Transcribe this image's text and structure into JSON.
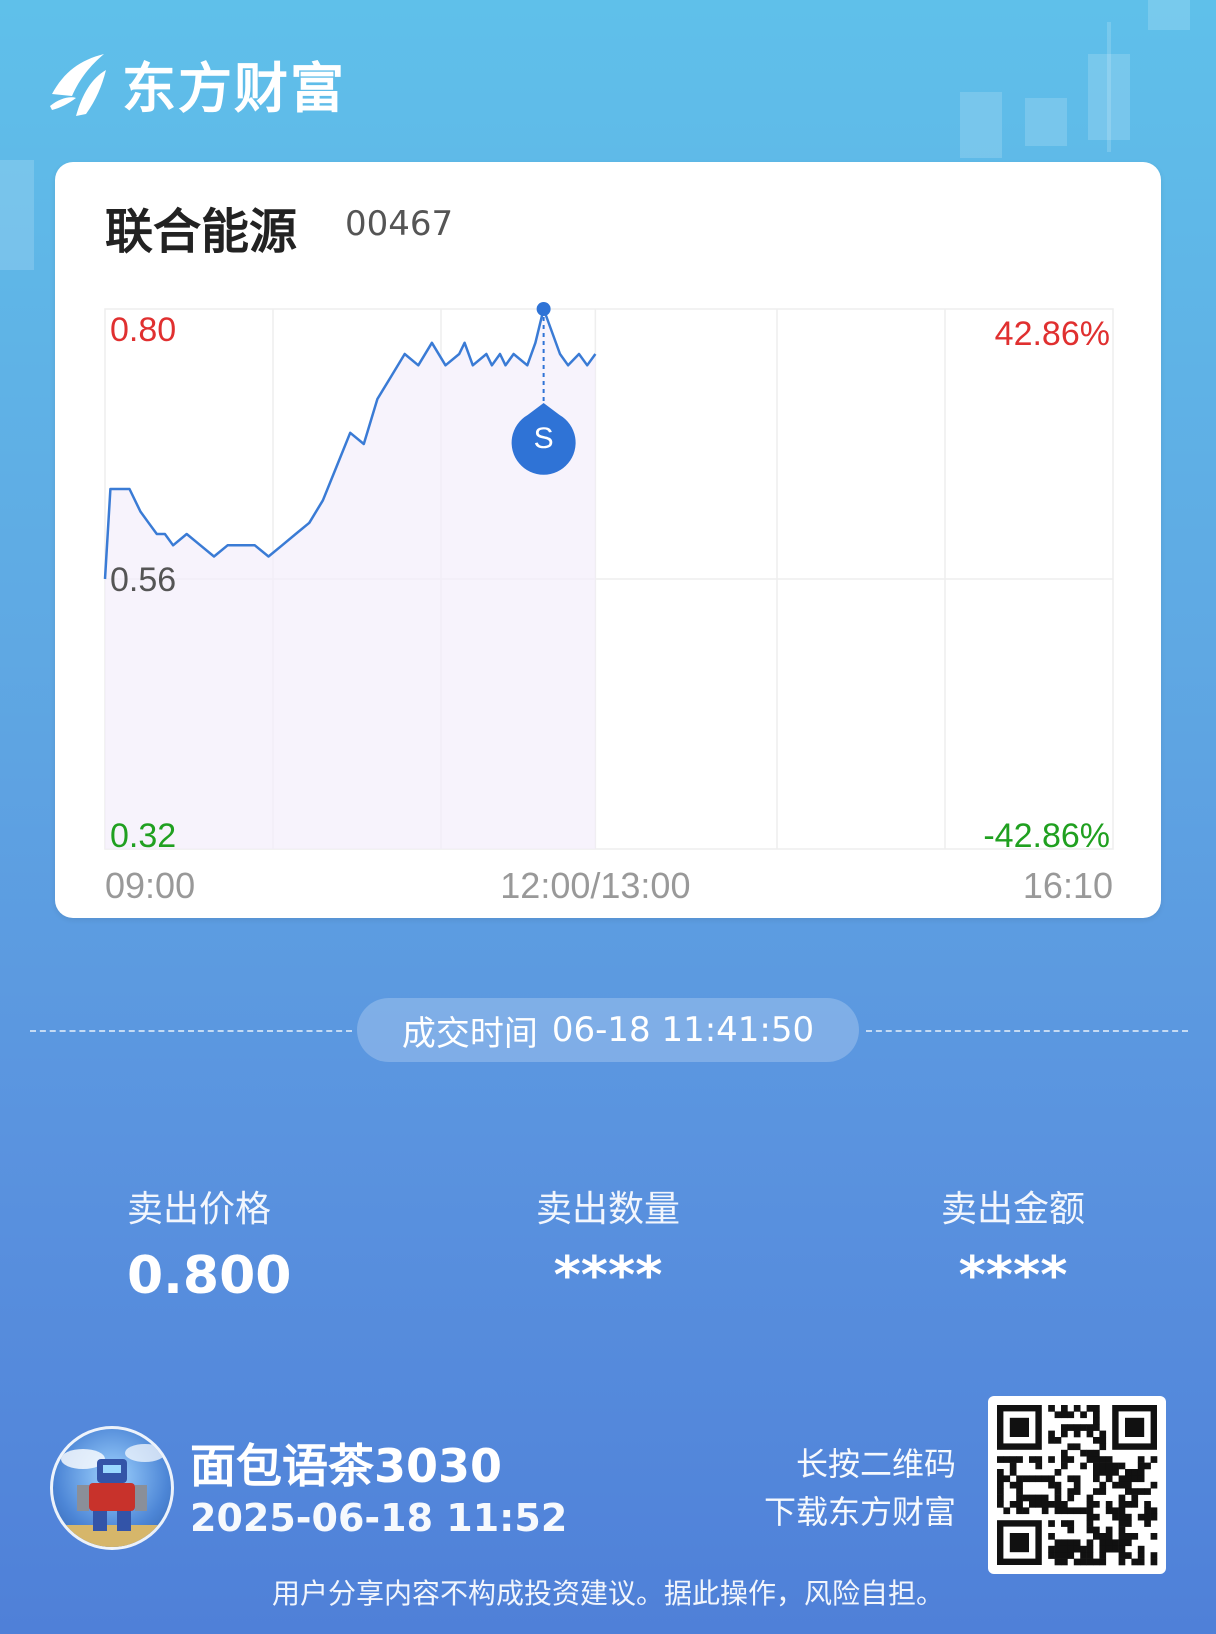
{
  "brand": {
    "name": "东方财富"
  },
  "stock": {
    "name": "联合能源",
    "code": "00467"
  },
  "chart_data": {
    "type": "line",
    "y_left_ticks": [
      "0.80",
      "0.56",
      "0.32"
    ],
    "y_right_ticks": [
      "42.86%",
      "-42.86%"
    ],
    "x_ticks": [
      "09:00",
      "12:00/13:00",
      "16:10"
    ],
    "ylim": [
      0.32,
      0.8
    ],
    "grid": true,
    "colors": {
      "line": "#3a7bd5",
      "up": "#e03030",
      "flat": "#555555",
      "down": "#20a020",
      "grid": "#eeeeee",
      "marker": "#2f73d6"
    },
    "series": [
      {
        "x": [
          "09:00",
          "09:02",
          "09:05",
          "09:09",
          "09:13",
          "09:16",
          "09:19",
          "09:22",
          "09:25",
          "09:30",
          "09:35",
          "09:40",
          "09:45",
          "09:50",
          "09:55",
          "10:00",
          "10:05",
          "10:10",
          "10:15",
          "10:20",
          "10:25",
          "10:30",
          "10:35",
          "10:40",
          "10:45",
          "10:50",
          "10:55",
          "11:00",
          "11:05",
          "11:10",
          "11:12",
          "11:15",
          "11:20",
          "11:22",
          "11:25",
          "11:27",
          "11:30",
          "11:35",
          "11:38",
          "11:41",
          "11:44",
          "11:47",
          "11:50",
          "11:54",
          "11:57",
          "12:00"
        ],
        "y": [
          0.56,
          0.64,
          0.64,
          0.64,
          0.62,
          0.61,
          0.6,
          0.6,
          0.59,
          0.6,
          0.59,
          0.58,
          0.59,
          0.59,
          0.59,
          0.58,
          0.59,
          0.6,
          0.61,
          0.63,
          0.66,
          0.69,
          0.68,
          0.72,
          0.74,
          0.76,
          0.75,
          0.77,
          0.75,
          0.76,
          0.77,
          0.75,
          0.76,
          0.75,
          0.76,
          0.75,
          0.76,
          0.75,
          0.77,
          0.8,
          0.78,
          0.76,
          0.75,
          0.76,
          0.75,
          0.76
        ]
      }
    ],
    "marker": {
      "x": "11:41",
      "y": 0.8,
      "label": "S"
    }
  },
  "trade": {
    "label": "成交时间",
    "time": "06-18 11:41:50"
  },
  "metrics": [
    {
      "label": "卖出价格",
      "value": "0.800"
    },
    {
      "label": "卖出数量",
      "value": "****"
    },
    {
      "label": "卖出金额",
      "value": "****"
    }
  ],
  "user": {
    "name": "面包语茶3030",
    "time": "2025-06-18 11:52"
  },
  "qr_hint": {
    "line1": "长按二维码",
    "line2": "下载东方财富"
  },
  "disclaimer": "用户分享内容不构成投资建议。据此操作，风险自担。"
}
